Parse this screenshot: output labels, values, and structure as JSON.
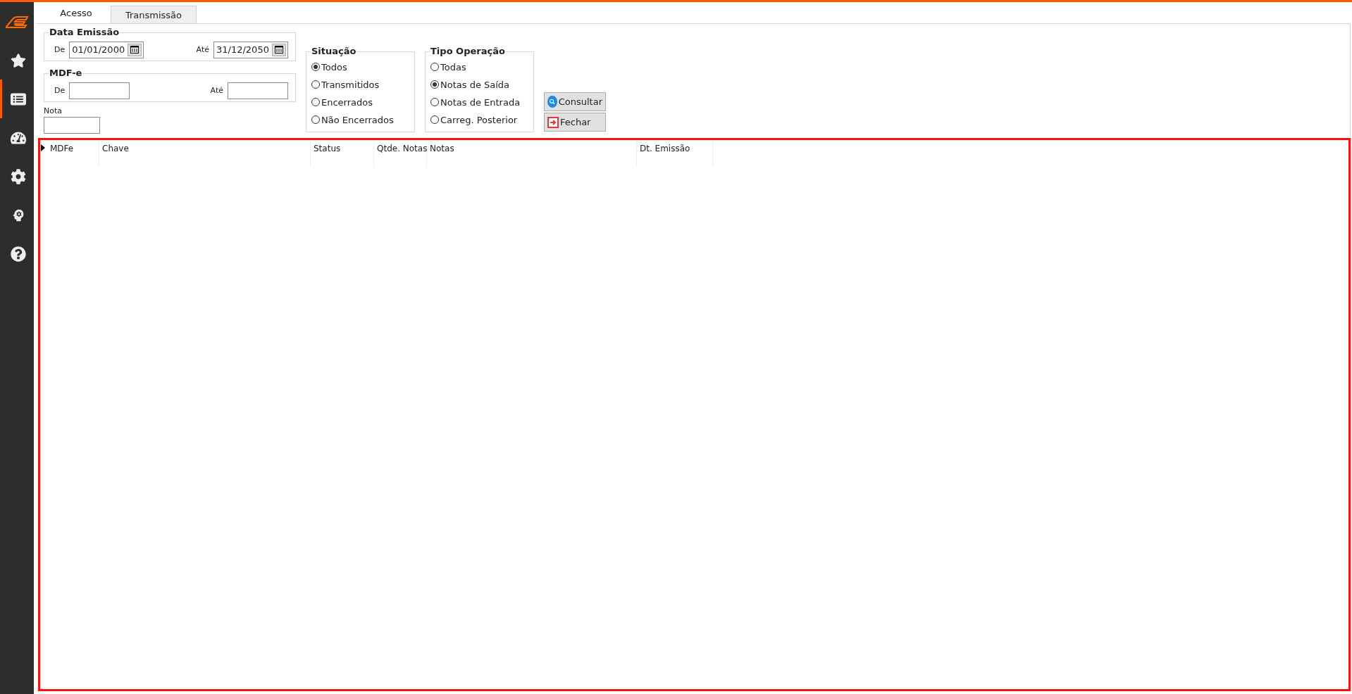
{
  "sidebar": {
    "items": [
      {
        "kind": "star",
        "selected": false
      },
      {
        "kind": "report",
        "selected": true
      },
      {
        "kind": "gauge",
        "selected": false
      },
      {
        "kind": "gear",
        "selected": false
      },
      {
        "kind": "head",
        "selected": false
      },
      {
        "kind": "help",
        "selected": false
      }
    ]
  },
  "tabs": [
    {
      "label": "Acesso",
      "selected": true
    },
    {
      "label": "Transmissão",
      "selected": false
    }
  ],
  "data_emissao": {
    "title": "Data Emissão",
    "from_label": "De",
    "from_value": "01/01/2000",
    "to_label": "Até",
    "to_value": "31/12/2050"
  },
  "mdfe": {
    "title": "MDF-e",
    "from_label": "De",
    "to_label": "Até"
  },
  "nota": {
    "label": "Nota"
  },
  "situacao": {
    "title": "Situação",
    "options": [
      {
        "label": "Todos",
        "selected": true
      },
      {
        "label": "Transmitidos",
        "selected": false
      },
      {
        "label": "Encerrados",
        "selected": false
      },
      {
        "label": "Não Encerrados",
        "selected": false
      }
    ]
  },
  "tipo_operacao": {
    "title": "Tipo Operação",
    "options": [
      {
        "label": "Todas",
        "selected": false
      },
      {
        "label": "Notas de Saída",
        "selected": true
      },
      {
        "label": "Notas de Entrada",
        "selected": false
      },
      {
        "label": "Carreg. Posterior",
        "selected": false
      }
    ]
  },
  "buttons": [
    {
      "kind": "search",
      "label": "Consultar"
    },
    {
      "kind": "close",
      "label": "Fechar"
    }
  ],
  "table": {
    "columns": [
      "MDFe",
      "Chave",
      "Status",
      "Qtde. Notas",
      "Notas",
      "Dt. Emissão"
    ]
  }
}
